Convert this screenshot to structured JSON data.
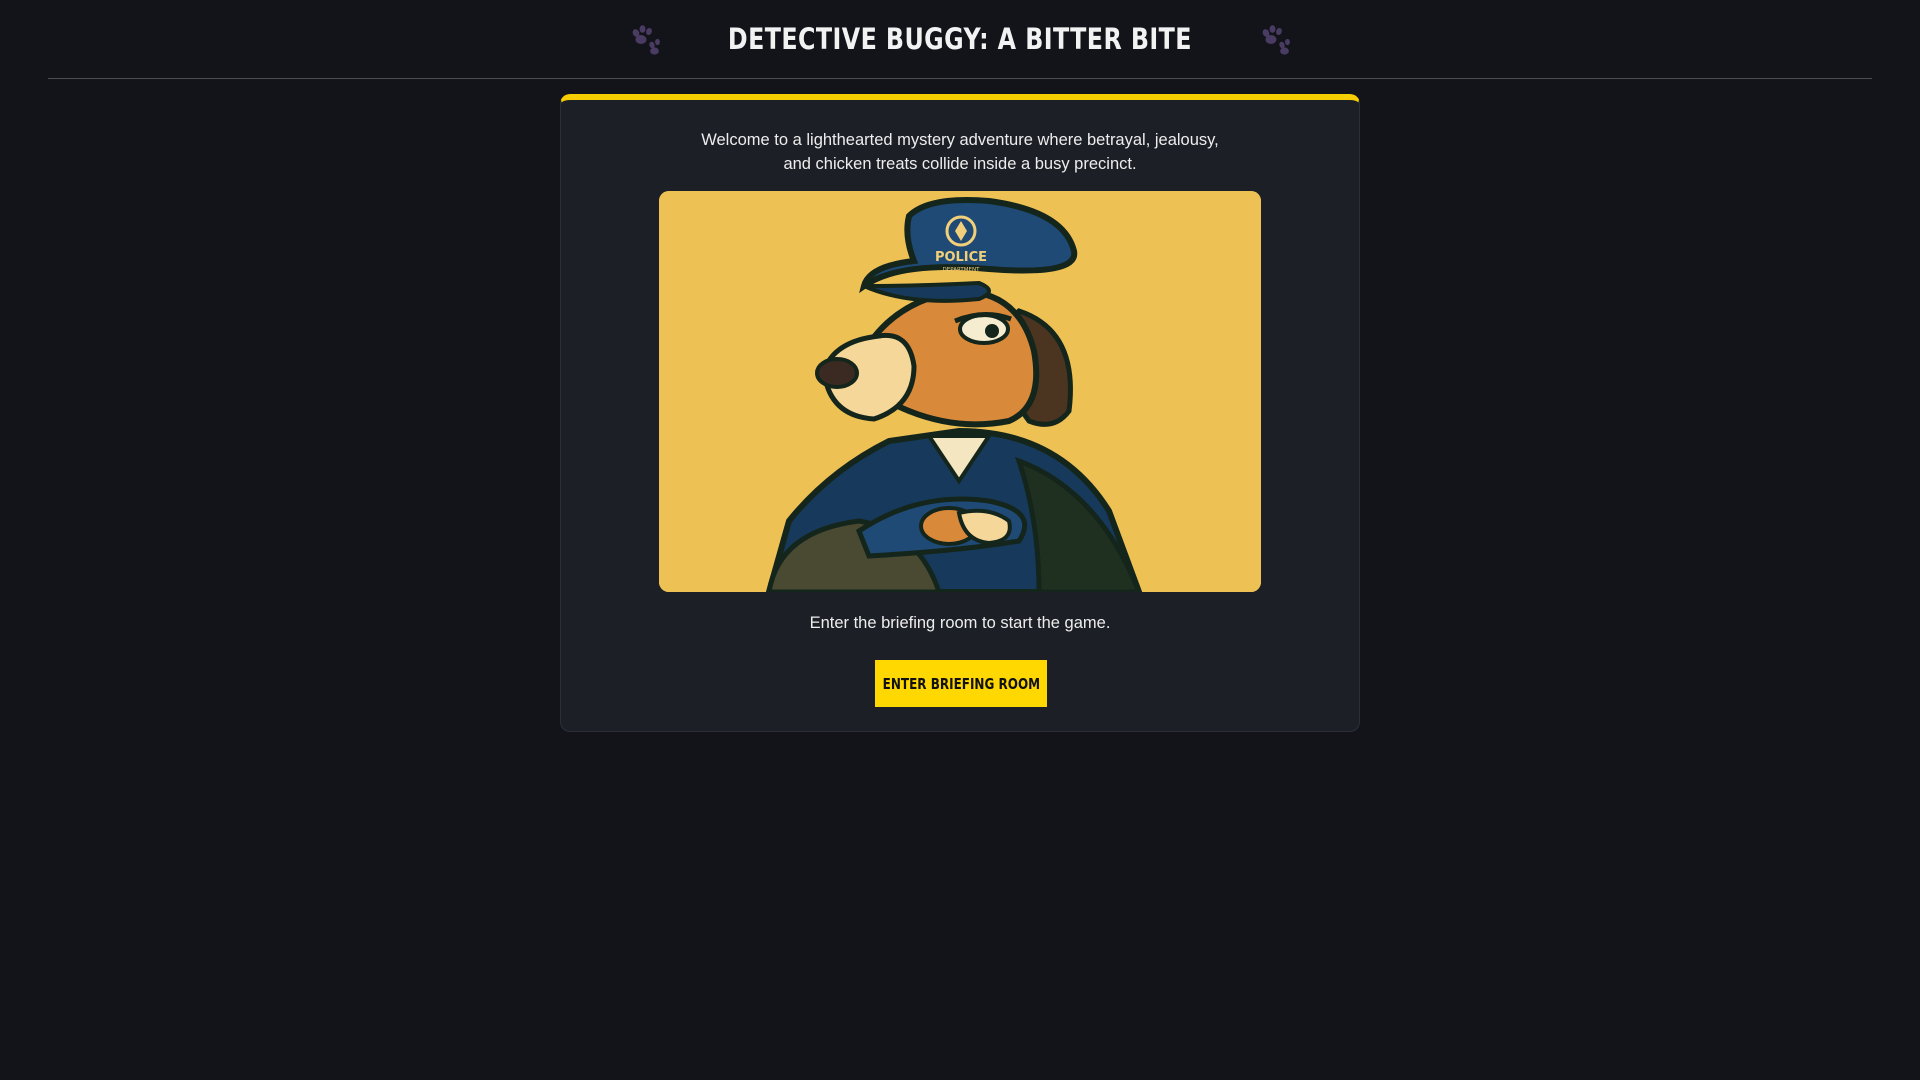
{
  "header": {
    "title": "Detective Buggy: A Bitter Bite",
    "left_icon": "paw-icon",
    "right_icon": "paw-icon"
  },
  "card": {
    "intro_line1": "Welcome to a lighthearted mystery adventure where betrayal, jealousy,",
    "intro_line2": "and chicken treats collide inside a busy precinct.",
    "image": {
      "subject": "beagle-police-officer-illustration",
      "cap_text": "POLICE",
      "cap_subtext": "DEPARTMENT"
    },
    "cta_text": "Enter the briefing room to start the game.",
    "cta_button_label": "Enter Briefing Room"
  },
  "colors": {
    "background": "#121419",
    "card": "#1c1f26",
    "accent": "#fed800",
    "paw": "#4a3b63"
  }
}
